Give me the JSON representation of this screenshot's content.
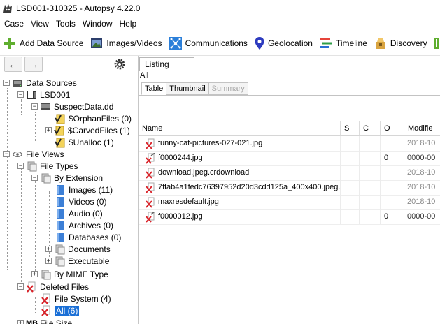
{
  "window": {
    "title": "LSD001-310325 - Autopsy 4.22.0"
  },
  "menu": [
    "Case",
    "View",
    "Tools",
    "Window",
    "Help"
  ],
  "toolbar": {
    "add_data_source": "Add Data Source",
    "images_videos": "Images/Videos",
    "communications": "Communications",
    "geolocation": "Geolocation",
    "timeline": "Timeline",
    "discovery": "Discovery"
  },
  "tree": {
    "data_sources": "Data Sources",
    "lsd001": "LSD001",
    "suspect_data": "SuspectData.dd",
    "orphan_files": "$OrphanFiles (0)",
    "carved_files": "$CarvedFiles (1)",
    "unalloc": "$Unalloc (1)",
    "file_views": "File Views",
    "file_types": "File Types",
    "by_extension": "By Extension",
    "images": "Images (11)",
    "videos": "Videos (0)",
    "audio": "Audio (0)",
    "archives": "Archives (0)",
    "databases": "Databases (0)",
    "documents": "Documents",
    "executable": "Executable",
    "by_mime": "By MIME Type",
    "deleted_files": "Deleted Files",
    "file_system": "File System (4)",
    "all": "All (6)",
    "file_size": "File Size"
  },
  "listing": {
    "tab": "Listing",
    "path_label": "All",
    "subtabs": [
      "Table",
      "Thumbnail",
      "Summary"
    ],
    "columns": [
      "Name",
      "S",
      "C",
      "O",
      "Modifie"
    ],
    "rows": [
      {
        "name": "funny-cat-pictures-027-021.jpg",
        "o": "",
        "modified": "2018-10"
      },
      {
        "name": "f0000244.jpg",
        "o": "0",
        "modified": "0000-00"
      },
      {
        "name": "download.jpeg.crdownload",
        "o": "",
        "modified": "2018-10"
      },
      {
        "name": "7ffab4a1fedc76397952d20d3cdd125a_400x400.jpeg.",
        "o": "",
        "modified": "2018-10"
      },
      {
        "name": "maxresdefault.jpg",
        "o": "",
        "modified": "2018-10"
      },
      {
        "name": "f0000012.jpg",
        "o": "0",
        "modified": "0000-00"
      }
    ]
  },
  "colors": {
    "selection": "#1a6fd6",
    "deleted_x": "#d9232a"
  }
}
